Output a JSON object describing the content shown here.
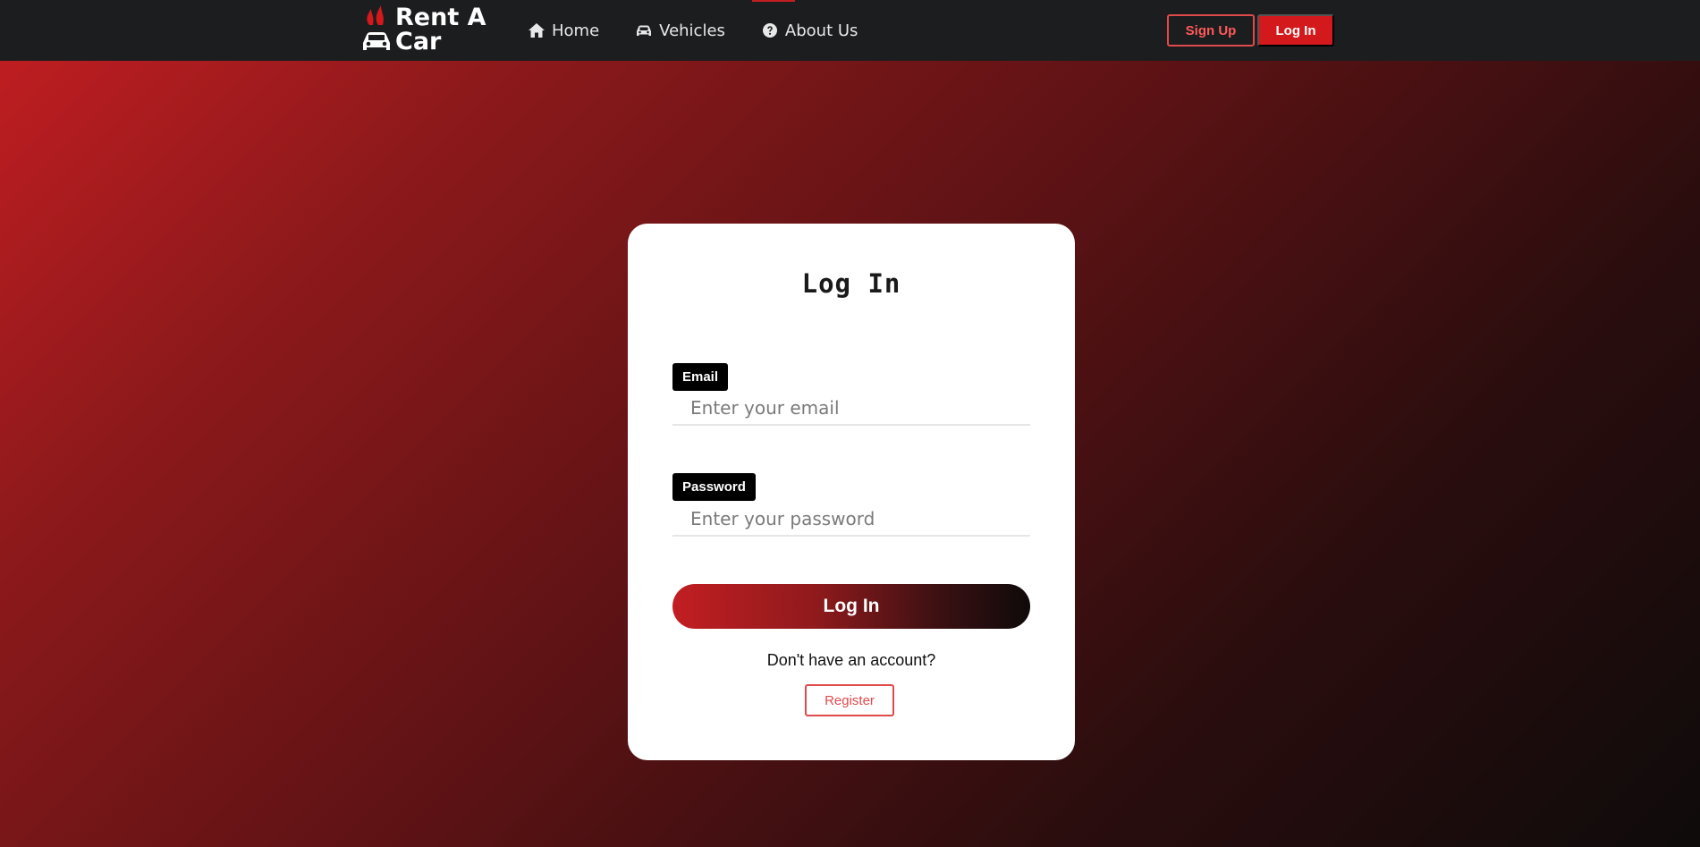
{
  "brand": {
    "name": "Rent A Car",
    "accent": "#c41e22"
  },
  "nav": {
    "links": [
      {
        "label": "Home",
        "icon": "home-icon"
      },
      {
        "label": "Vehicles",
        "icon": "car-icon"
      },
      {
        "label": "About Us",
        "icon": "question-circle-icon"
      }
    ],
    "signup_label": "Sign Up",
    "login_label": "Log In"
  },
  "login_card": {
    "title": "Log In",
    "email": {
      "label": "Email",
      "placeholder": "Enter your email",
      "value": ""
    },
    "password": {
      "label": "Password",
      "placeholder": "Enter your password",
      "value": ""
    },
    "submit_label": "Log In",
    "no_account_text": "Don't have an account?",
    "register_label": "Register"
  },
  "colors": {
    "navbar_bg": "#1c1d1f",
    "primary_red": "#d3191c",
    "outline_red": "#e04a4a"
  }
}
